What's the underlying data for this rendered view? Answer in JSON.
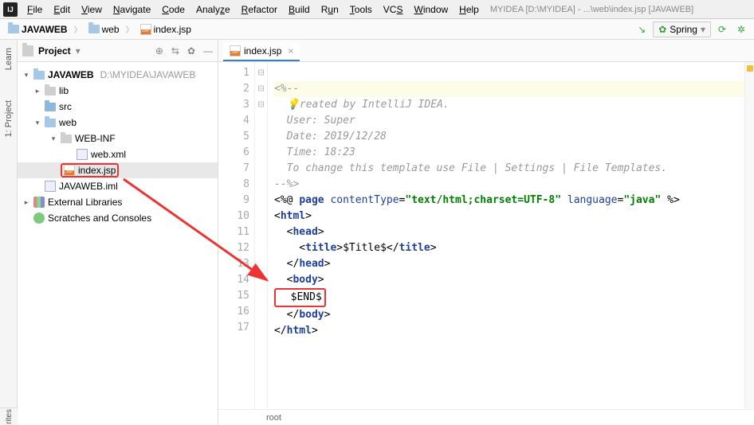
{
  "menu": {
    "items": [
      "File",
      "Edit",
      "View",
      "Navigate",
      "Code",
      "Analyze",
      "Refactor",
      "Build",
      "Run",
      "Tools",
      "VCS",
      "Window",
      "Help"
    ],
    "underline": [
      "F",
      "E",
      "V",
      "N",
      "C",
      "",
      "R",
      "B",
      "R",
      "T",
      "",
      "W",
      "H"
    ],
    "title": "MYIDEA [D:\\MYIDEA] - ...\\web\\index.jsp [JAVAWEB]"
  },
  "breadcrumbs": {
    "root": "JAVAWEB",
    "mid": "web",
    "file": "index.jsp"
  },
  "navbar": {
    "spring": "Spring"
  },
  "side_tabs": {
    "learn": "Learn",
    "project": "1: Project",
    "favorites": "rites"
  },
  "project_panel": {
    "label": "Project",
    "root": {
      "name": "JAVAWEB",
      "path": "D:\\MYIDEA\\JAVAWEB"
    },
    "lib": "lib",
    "src": "src",
    "web": "web",
    "webinf": "WEB-INF",
    "webxml": "web.xml",
    "indexjsp": "index.jsp",
    "iml": "JAVAWEB.iml",
    "ext": "External Libraries",
    "scratch": "Scratches and Consoles"
  },
  "tab": {
    "name": "index.jsp"
  },
  "code": {
    "l1": "<%--",
    "l2a": "  ",
    "l2b": "reated by IntelliJ IDEA.",
    "l3": "  User: Super",
    "l4": "  Date: 2019/12/28",
    "l5": "  Time: 18:23",
    "l6": "  To change this template use File | Settings | File Templates.",
    "l7": "--%>",
    "l8_pre": "<%@ ",
    "l8_page": "page ",
    "l8_ct": "contentType",
    "l8_eq": "=",
    "l8_ctv": "\"text/html;charset=UTF-8\"",
    "l8_sp": " ",
    "l8_lang": "language",
    "l8_langv": "\"java\"",
    "l8_end": " %>",
    "l9o": "<",
    "l9t": "html",
    "l9c": ">",
    "l10o": "  <",
    "l10t": "head",
    "l10c": ">",
    "l11o": "    <",
    "l11t": "title",
    "l11c": ">",
    "l11txt": "$Title$",
    "l11co": "</",
    "l11cc": ">",
    "l12o": "  </",
    "l12t": "head",
    "l12c": ">",
    "l13o": "  <",
    "l13t": "body",
    "l13c": ">",
    "l14": "  $END$",
    "l15o": "  </",
    "l15t": "body",
    "l15c": ">",
    "l16o": "</",
    "l16t": "html",
    "l16c": ">"
  },
  "editor_breadcrumb": "root",
  "line_numbers": [
    "1",
    "2",
    "3",
    "4",
    "5",
    "6",
    "7",
    "8",
    "9",
    "10",
    "11",
    "12",
    "13",
    "14",
    "15",
    "16",
    "17"
  ],
  "fold_marks": [
    "⊟",
    "",
    "",
    "",
    "",
    "",
    "",
    "",
    "⊟",
    "",
    "",
    "",
    "",
    "",
    "",
    "",
    "⊟"
  ]
}
